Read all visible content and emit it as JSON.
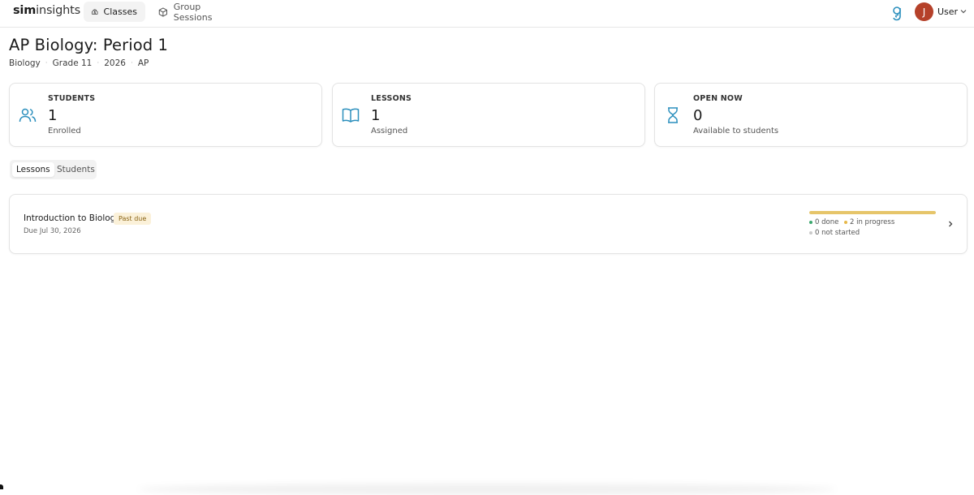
{
  "app": {
    "logo_bold": "sim",
    "logo_light": "insights"
  },
  "nav": {
    "tabs": [
      {
        "label": "Classes",
        "icon": "school-icon",
        "active": true
      },
      {
        "label": "Group Sessions",
        "icon": "cube-icon",
        "active": false
      }
    ]
  },
  "user": {
    "avatar_initial": "J",
    "name": "User",
    "avatar_color": "#b5412a"
  },
  "class": {
    "title": "AP Biology: Period 1",
    "meta": [
      "Biology",
      "Grade 11",
      "2026",
      "AP"
    ]
  },
  "stats": [
    {
      "label": "STUDENTS",
      "value": "1",
      "sub": "Enrolled",
      "icon": "users-icon"
    },
    {
      "label": "LESSONS",
      "value": "1",
      "sub": "Assigned",
      "icon": "book-icon"
    },
    {
      "label": "OPEN NOW",
      "value": "0",
      "sub": "Available to students",
      "icon": "hourglass-icon"
    }
  ],
  "tabs": [
    {
      "label": "Lessons",
      "active": true
    },
    {
      "label": "Students",
      "active": false
    }
  ],
  "lessons": [
    {
      "title": "Introduction to Biology",
      "badge": "Past due",
      "due": "Due Jul 30, 2026",
      "progress_fraction": 1.0,
      "done": "0 done",
      "in_progress": "2 in progress",
      "not_started": "0 not started"
    }
  ],
  "colors": {
    "accent_icon": "#2b8fbd",
    "progress": "#e6c56a",
    "done_dot": "#3aa76d",
    "in_progress_dot": "#e6b84a",
    "not_started_dot": "#c9c9c9",
    "badge_bg": "#fbf1d9"
  }
}
